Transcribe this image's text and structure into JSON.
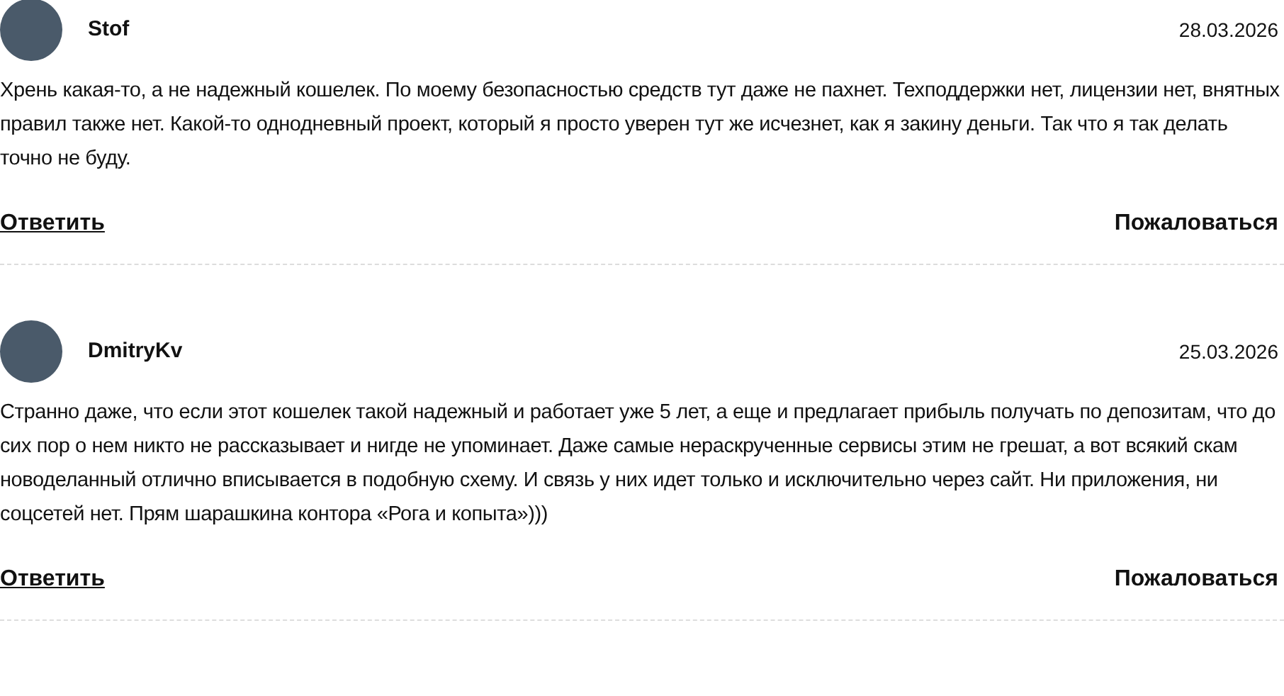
{
  "comments": [
    {
      "author": "Stof",
      "date": "28.03.2026",
      "text": "Хрень какая-то, а не надежный кошелек. По моему безопасностью средств тут даже не пахнет. Техподдержки нет, лицензии нет, внятных правил также нет. Какой-то однодневный проект, который я просто уверен тут же исчезнет, как я закину деньги. Так что я так делать точно не буду.",
      "reply": "Ответить",
      "report": "Пожаловаться"
    },
    {
      "author": "DmitryKv",
      "date": "25.03.2026",
      "text": "Странно даже, что если этот кошелек такой надежный и работает уже 5 лет, а еще и предлагает прибыль получать по депозитам, что до сих пор о нем никто не рассказывает и нигде не упоминает. Даже самые нераскрученные сервисы этим не грешат, а вот всякий скам новоделанный отлично вписывается в подобную схему. И связь у них идет только и исключительно через сайт. Ни приложения, ни соцсетей нет. Прям шарашкина контора «Рога и копыта»)))",
      "reply": "Ответить",
      "report": "Пожаловаться"
    }
  ]
}
